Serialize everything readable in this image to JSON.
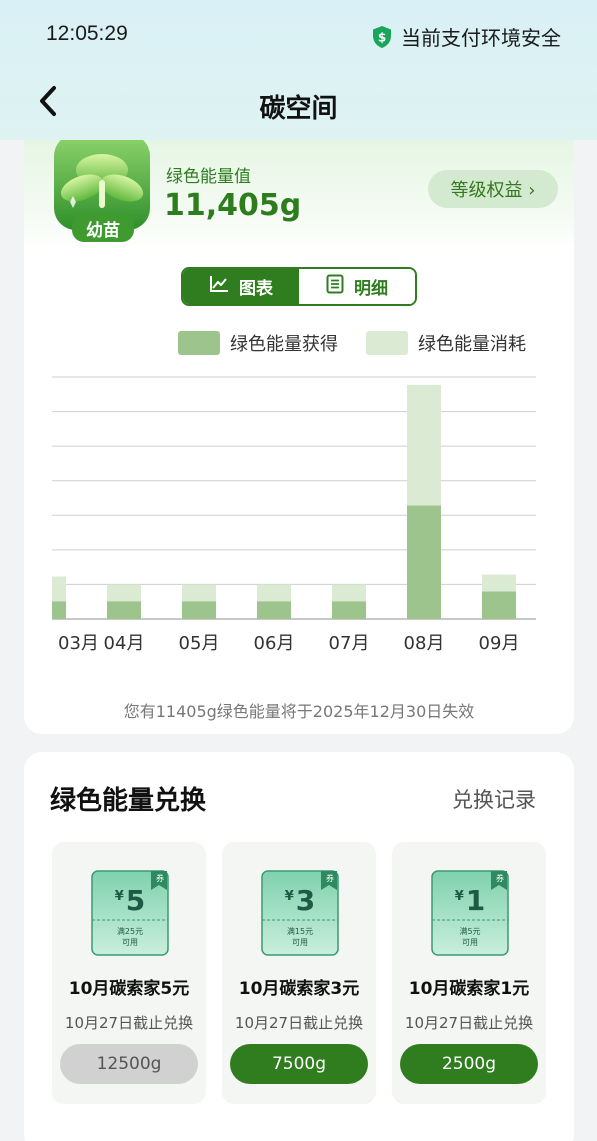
{
  "status_bar": {
    "time": "12:05:29",
    "security_text": "当前支付环境安全",
    "security_icon": "shield-dollar-icon"
  },
  "nav": {
    "title": "碳空间",
    "back_icon": "chevron-left-icon"
  },
  "energy": {
    "badge_label": "幼苗",
    "label": "绿色能量值",
    "value": "11,405g",
    "level_button": "等级权益 ›"
  },
  "toggle": {
    "chart_label": "图表",
    "detail_label": "明细",
    "active": "chart"
  },
  "legend": {
    "gain": "绿色能量获得",
    "use": "绿色能量消耗"
  },
  "colors": {
    "brand_green": "#2f7d1f",
    "gain_color": "#9cc48c",
    "use_color": "#dbead3"
  },
  "chart_data": {
    "type": "bar",
    "stacked": true,
    "categories": [
      "03月",
      "04月",
      "05月",
      "06月",
      "07月",
      "08月",
      "09月"
    ],
    "series": [
      {
        "name": "绿色能量获得",
        "values": [
          18,
          18,
          18,
          18,
          18,
          115,
          28
        ]
      },
      {
        "name": "绿色能量消耗",
        "values": [
          25,
          17,
          17,
          17,
          17,
          122,
          17
        ]
      }
    ],
    "xlabel": "",
    "ylabel": "",
    "ylim": [
      0,
      245
    ],
    "grid": true,
    "legend_position": "top-right"
  },
  "expire_note": "您有11405g绿色能量将于2025年12月30日失效",
  "exchange": {
    "title": "绿色能量兑换",
    "record_link": "兑换记录",
    "items": [
      {
        "amount": "5",
        "yen": "¥",
        "condition": "满25元",
        "usable": "可用",
        "tag": "券",
        "name": "10月碳索家5元",
        "deadline": "10月27日截止兑换",
        "cost": "12500g",
        "enabled": false
      },
      {
        "amount": "3",
        "yen": "¥",
        "condition": "满15元",
        "usable": "可用",
        "tag": "券",
        "name": "10月碳索家3元",
        "deadline": "10月27日截止兑换",
        "cost": "7500g",
        "enabled": true
      },
      {
        "amount": "1",
        "yen": "¥",
        "condition": "满5元",
        "usable": "可用",
        "tag": "券",
        "name": "10月碳索家1元",
        "deadline": "10月27日截止兑换",
        "cost": "2500g",
        "enabled": true
      }
    ]
  }
}
